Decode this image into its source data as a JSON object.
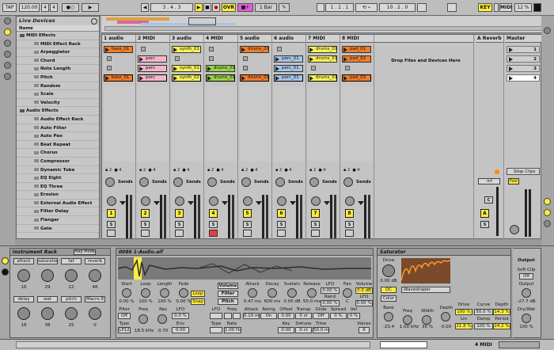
{
  "transport": {
    "tap": "TAP",
    "tempo": "120.00",
    "sig_num": "4",
    "sig_den": "4",
    "position": "3 . 4 . 3",
    "ovr": "OVR",
    "quantize": "1 Bar",
    "loop_start": "1 . 1 . 1",
    "loop_len": "10 . 2 . 0",
    "key": "KEY",
    "midi": "MIDI",
    "cpu": "12 %"
  },
  "browser": {
    "title": "Live Devices",
    "column": "Name",
    "items": [
      {
        "label": "MIDI Effects",
        "level": 0
      },
      {
        "label": "MIDI Effect Rack",
        "level": 1
      },
      {
        "label": "Arpeggiator",
        "level": 1
      },
      {
        "label": "Chord",
        "level": 1
      },
      {
        "label": "Note Length",
        "level": 1
      },
      {
        "label": "Pitch",
        "level": 1
      },
      {
        "label": "Random",
        "level": 1
      },
      {
        "label": "Scale",
        "level": 1
      },
      {
        "label": "Velocity",
        "level": 1
      },
      {
        "label": "Audio Effects",
        "level": 0
      },
      {
        "label": "Audio Effect Rack",
        "level": 1
      },
      {
        "label": "Auto Filter",
        "level": 1
      },
      {
        "label": "Auto Pan",
        "level": 1
      },
      {
        "label": "Beat Repeat",
        "level": 1
      },
      {
        "label": "Chorus",
        "level": 1
      },
      {
        "label": "Compressor",
        "level": 1
      },
      {
        "label": "Dynamic Tube",
        "level": 1
      },
      {
        "label": "EQ Eight",
        "level": 1
      },
      {
        "label": "EQ Three",
        "level": 1
      },
      {
        "label": "Erosion",
        "level": 1
      },
      {
        "label": "External Audio Effect",
        "level": 1
      },
      {
        "label": "Filter Delay",
        "level": 1
      },
      {
        "label": "Flanger",
        "level": 1
      },
      {
        "label": "Gate",
        "level": 1
      }
    ]
  },
  "session": {
    "tracks": [
      {
        "name": "1 audio",
        "num": "1",
        "clips": [
          {
            "label": "bass_01",
            "color": "#f07d2a",
            "row": 0
          },
          {
            "label": "bass_01",
            "color": "#f07d2a",
            "row": 3
          }
        ]
      },
      {
        "name": "2 MIDI",
        "num": "2",
        "clips": [
          {
            "label": "perc",
            "color": "#f5b5c8",
            "row": 1
          },
          {
            "label": "perc",
            "color": "#f5b5c8",
            "row": 2
          },
          {
            "label": "perc",
            "color": "#f5b5c8",
            "row": 3
          }
        ]
      },
      {
        "name": "3 audio",
        "num": "3",
        "clips": [
          {
            "label": "synth_01",
            "color": "#f7f25a",
            "row": 0
          },
          {
            "label": "synth_01",
            "color": "#f7f25a",
            "row": 2
          },
          {
            "label": "synth_02",
            "color": "#f7f25a",
            "row": 3
          }
        ]
      },
      {
        "name": "4 MIDI",
        "num": "4",
        "clips": [
          {
            "label": "drums_01",
            "color": "#9ad24a",
            "row": 2
          },
          {
            "label": "drums_01",
            "color": "#9ad24a",
            "row": 3
          }
        ]
      },
      {
        "name": "5 audio",
        "num": "5",
        "clips": [
          {
            "label": "drums_01",
            "color": "#f07d2a",
            "row": 0
          },
          {
            "label": "drums_01",
            "color": "#f07d2a",
            "row": 3
          }
        ]
      },
      {
        "name": "6 audio",
        "num": "6",
        "clips": [
          {
            "label": "perc_01",
            "color": "#a8c4e8",
            "row": 1
          },
          {
            "label": "perc_01",
            "color": "#a8c4e8",
            "row": 2
          },
          {
            "label": "perc_01",
            "color": "#a8c4e8",
            "row": 3
          }
        ]
      },
      {
        "name": "7 MIDI",
        "num": "7",
        "clips": [
          {
            "label": "drums_01",
            "color": "#f7f25a",
            "row": 0
          },
          {
            "label": "drums_01",
            "color": "#f7f25a",
            "row": 1
          },
          {
            "label": "drums_01",
            "color": "#f7f25a",
            "row": 3
          }
        ]
      },
      {
        "name": "8 MIDI",
        "num": "8",
        "clips": [
          {
            "label": "pad_01",
            "color": "#f07d2a",
            "row": 0
          },
          {
            "label": "pad_02",
            "color": "#f07d2a",
            "row": 1
          },
          {
            "label": "pad_03",
            "color": "#f07d2a",
            "row": 3
          }
        ]
      }
    ],
    "drop_hint": "Drop Files and Devices Here",
    "return_name": "A Reverb",
    "master_name": "Master",
    "scenes": [
      "1",
      "2",
      "3",
      "4"
    ],
    "sends_label": "Sends",
    "stop_clips": "Stop Clips",
    "return_send": "A",
    "return_inf": "-inf",
    "post": "Post",
    "cue": "C",
    "solo": "S"
  },
  "instrument_rack": {
    "title": "Instrument Rack",
    "map_mode": "Map Mode",
    "macros": [
      {
        "label": "attack",
        "value": "16"
      },
      {
        "label": "saturator",
        "value": "29"
      },
      {
        "label": "fat",
        "value": "22"
      },
      {
        "label": "reverb",
        "value": "48"
      },
      {
        "label": "delay",
        "value": "18"
      },
      {
        "label": "wet",
        "value": "38"
      },
      {
        "label": "pitch",
        "value": "25"
      },
      {
        "label": "Macro 8",
        "value": "0"
      }
    ]
  },
  "clip_detail": {
    "title": "0086 1-Audio.aif",
    "fields": [
      {
        "label": "Start",
        "value": "0.00 %"
      },
      {
        "label": "Loop",
        "value": "100 %"
      },
      {
        "label": "Length",
        "value": "100 %"
      },
      {
        "label": "Fade",
        "value": "0.00 %"
      }
    ],
    "loop": "Loop",
    "snap": "Snap",
    "filter_label": "Filter",
    "filter_val": "Off",
    "freq_label": "Freq",
    "freq_val": "18.5 kHz",
    "res_label": "Res",
    "res_val": "0.70",
    "type_label": "Type",
    "type_val": "LP12",
    "lfo_label": "LFO",
    "lfo_val": "0.0 %",
    "env_label": "Env",
    "env_val": "0.00",
    "volume": "Volume",
    "filter_btn": "Filter",
    "pitch_btn": "Pitch",
    "lfo2": "LFO",
    "type2": "Type",
    "freq2": "Freq",
    "rate": "Rate",
    "freq2_val": "1.00 Hz",
    "attack_label": "Attack",
    "attack_val": "0.47 ms",
    "decay_label": "Decay",
    "decay_val": "600 ms",
    "sustain_label": "Sustain",
    "sustain_val": "0.00 dB",
    "release_label": "Release",
    "release_val": "50.0 ms",
    "lfo3_label": "LFO",
    "lfo3_val": "0.00 %",
    "rand_label": "Rand",
    "rand_val": "0.00 %",
    "pan_label": "Pan",
    "pan_val": "C",
    "volume_label": "Volume",
    "volume_val": "0.0 dB",
    "lfo4_label": "LFO",
    "lfo4_val": "0.00 %",
    "attack2": "Attack",
    "attack2_val": "0.10 ms",
    "retrig": "Retrig",
    "retrig_val": "On",
    "transp": "Transp",
    "transp_val": "0 st",
    "glide": "Glide",
    "glide_val": "Off",
    "spread": "Spread",
    "spread_val": "0 %",
    "vel": "Vel",
    "vel_val": "0 %",
    "key": "Key",
    "key_val": "0.00",
    "offset": "Offset",
    "offset_val": "0.00",
    "detune": "Detune",
    "detune_val": "0 ct",
    "time": "Time",
    "time_val": "50.0 ms",
    "voices": "Voices",
    "voices_val": "6"
  },
  "saturator": {
    "title": "Saturator",
    "drive_label": "Drive",
    "drive_val": "0.00 dB",
    "dc": "DC",
    "color": "Color",
    "mode": "Waveshaper",
    "base_label": "Base",
    "base_val": "-23.4",
    "freq_label": "Freq",
    "freq_val": "1.00 kHz",
    "width_label": "Width",
    "width_val": "30 %",
    "depth_label": "Depth",
    "depth_val": "0.00",
    "drive2_label": "Drive",
    "drive2_val": "100 %",
    "curve_label": "Curve",
    "curve_val": "50.0 %",
    "depth2_label": "Depth",
    "depth2_val": "14.3 %",
    "lin_label": "Lin",
    "lin_val": "21.8 %",
    "damp_label": "Damp",
    "damp_val": "100 %",
    "period_label": "Period",
    "period_val": "24.2 %",
    "output_title": "Output",
    "softclip_label": "Soft Clip",
    "softclip_val": "Off",
    "output_label": "Output",
    "output_val": "-27.7 dB",
    "drywet_label": "Dry/Wet",
    "drywet_val": "100 %"
  },
  "status": {
    "track": "4 MIDI"
  }
}
